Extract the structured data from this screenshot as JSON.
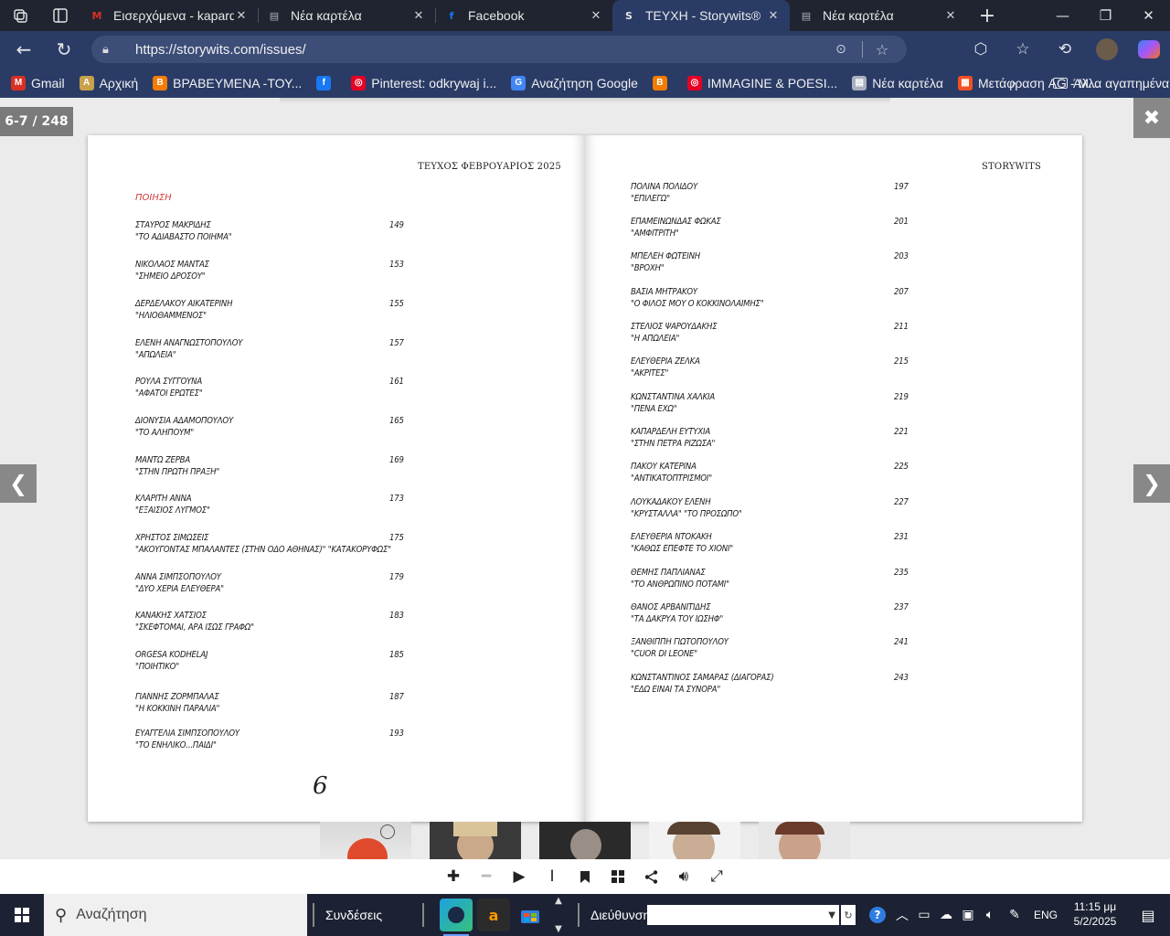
{
  "browser": {
    "tabs": [
      {
        "title": "Εισερχόμενα - kapardeli@",
        "icon": "gmail-icon",
        "color": "#d93025",
        "glyph": "M"
      },
      {
        "title": "Νέα καρτέλα",
        "icon": "newtab-page-icon",
        "color": "#aab0c0",
        "glyph": "▤"
      },
      {
        "title": "Facebook",
        "icon": "facebook-icon",
        "color": "#1877f2",
        "glyph": "f"
      },
      {
        "title": "ΤΕΥΧΗ - Storywits®",
        "icon": "storywits-icon",
        "color": "#e6e6e6",
        "glyph": "S",
        "active": true
      },
      {
        "title": "Νέα καρτέλα",
        "icon": "newtab-page-icon",
        "color": "#aab0c0",
        "glyph": "▤"
      }
    ],
    "url": "https://storywits.com/issues/",
    "bookmarks": [
      {
        "label": "Gmail",
        "color": "#d93025",
        "glyph": "M"
      },
      {
        "label": "Αρχική",
        "color": "#c8a24a",
        "glyph": "A"
      },
      {
        "label": "ΒΡΑΒΕΥΜΕΝΑ -ΤΟΥ...",
        "color": "#f57c00",
        "glyph": "B"
      },
      {
        "label": "",
        "color": "#1877f2",
        "glyph": "f"
      },
      {
        "label": "Pinterest: odkrywaj i...",
        "color": "#e60023",
        "glyph": "◎"
      },
      {
        "label": "Αναζήτηση Google",
        "color": "#4285f4",
        "glyph": "G"
      },
      {
        "label": "",
        "color": "#f57c00",
        "glyph": "B"
      },
      {
        "label": "IMMAGINE & POESI...",
        "color": "#e60023",
        "glyph": "◎"
      },
      {
        "label": "Νέα καρτέλα",
        "color": "#aab0c0",
        "glyph": "▤"
      },
      {
        "label": "Μετάφραση AG - M...",
        "color": "#f25022",
        "glyph": "▦"
      }
    ],
    "other_bookmarks": "Άλλα αγαπημένα"
  },
  "viewer": {
    "page_counter": "6-7 / 248",
    "left_page": {
      "header": "ΤΕΥΧΟΣ ΦΕΒΡΟΥΑΡΙΟΣ 2025",
      "section": "ΠΟΙΗΣΗ",
      "folio": "6",
      "entries": [
        {
          "author": "ΣΤΑΥΡΟΣ ΜΑΚΡΙΔΗΣ",
          "title": "\"ΤΟ ΑΔΙΑΒΑΣΤΟ ΠΟΙΗΜΑ\"",
          "page": "149"
        },
        {
          "author": "ΝΙΚΟΛΑΟΣ ΜΑΝΤΑΣ",
          "title": "\"ΣΗΜΕΙΟ ΔΡΟΣΟΥ\"",
          "page": "153"
        },
        {
          "author": "ΔΕΡΔΕΛΑΚΟΥ ΑΙΚΑΤΕΡΙΝΗ",
          "title": "\"ΗΛΙΟΘΑΜΜΕΝΟΣ\"",
          "page": "155"
        },
        {
          "author": "ΕΛΕΝΗ ΑΝΑΓΝΩΣΤΟΠΟΥΛΟΥ",
          "title": "\"ΑΠΩΛΕΙΑ\"",
          "page": "157"
        },
        {
          "author": "ΡΟΥΛΑ ΣΥΓΓΟΥΝΑ",
          "title": "\"ΑΦΑΤΟΙ ΕΡΩΤΕΣ\"",
          "page": "161"
        },
        {
          "author": "ΔΙΟΝΥΣΙΑ ΑΔΑΜΟΠΟΥΛΟΥ",
          "title": "\"ΤΟ ΑΛΗΠΟΥΜ\"",
          "page": "165"
        },
        {
          "author": "ΜΑΝΤΩ ΖΕΡΒΑ",
          "title": "\"ΣΤΗΝ ΠΡΩΤΗ ΠΡΑΞΗ\"",
          "page": "169"
        },
        {
          "author": "ΚΛΑΡΙΤΗ ΑΝΝΑ",
          "title": "\"ΕΞΑΙΣΙΟΣ ΛΥΓΜΟΣ\"",
          "page": "173"
        },
        {
          "author": "ΧΡΗΣΤΟΣ ΣΙΜΩΣΕΙΣ",
          "title": "\"ΑΚΟΥΓΟΝΤΑΣ ΜΠΑΛΑΝΤΕΣ (ΣΤΗΝ ΟΔΟ ΑΘΗΝΑΣ)\" \"ΚΑΤΑΚΟΡΥΦΩΣ\"",
          "page": "175"
        },
        {
          "author": "ΑΝΝΑ ΣΙΜΠΣΟΠΟΥΛΟΥ",
          "title": "\"ΔΥΟ ΧΕΡΙΑ ΕΛΕΥΘΕΡΑ\"",
          "page": "179"
        },
        {
          "author": "ΚΑΝΑΚΗΣ ΧΑΤΣΙΟΣ",
          "title": "\"ΣΚΕΦΤΟΜΑΙ, ΑΡΑ ΙΣΩΣ ΓΡΑΦΩ\"",
          "page": "183"
        },
        {
          "author": "ORGESA KODHELAJ",
          "title": "\"ΠΟΙΗΤΙΚΟ\"",
          "page": "185"
        },
        {
          "author": "ΓΙΑΝΝΗΣ ΖΟΡΜΠΑΛΑΣ",
          "title": "\"Η ΚΟΚΚΙΝΗ ΠΑΡΑΛΙΑ\"",
          "page": "187"
        },
        {
          "author": "ΕΥΑΓΓΕΛΙΑ ΣΙΜΠΣΟΠΟΥΛΟΥ",
          "title": "\"ΤΟ ΕΝΗΛΙΚΟ...ΠΑΙΔΙ\"",
          "page": "193"
        }
      ]
    },
    "right_page": {
      "header": "STORYWITS",
      "entries": [
        {
          "author": "ΠΟΛΙΝΑ ΠΟΛΙΔΟΥ",
          "title": "\"ΕΠΙΛΕΓΩ\"",
          "page": "197"
        },
        {
          "author": "ΕΠΑΜΕΙΝΩΝΔΑΣ ΦΩΚΑΣ",
          "title": "\"ΑΜΦΙΤΡΙΤΗ\"",
          "page": "201"
        },
        {
          "author": "ΜΠΕΛΕΗ ΦΩΤΕΙΝΗ",
          "title": "\"ΒΡΟΧΗ\"",
          "page": "203"
        },
        {
          "author": "ΒΑΣΙΑ ΜΗΤΡΑΚΟΥ",
          "title": "\"Ο ΦΙΛΟΣ ΜΟΥ Ο ΚΟΚΚΙΝΟΛΑΙΜΗΣ\"",
          "page": "207"
        },
        {
          "author": "ΣΤΕΛΙΟΣ ΨΑΡΟΥΔΑΚΗΣ",
          "title": "\"Η ΑΠΩΛΕΙΑ\"",
          "page": "211"
        },
        {
          "author": "ΕΛΕΥΘΕΡΙΑ ΖΕΛΚΑ",
          "title": "\"ΑΚΡΙΤΕΣ\"",
          "page": "215"
        },
        {
          "author": "ΚΩΝΣΤΑΝΤΙΝΑ ΧΑΛΚΙΑ",
          "title": "\"ΠΕΝΑ ΕΧΩ\"",
          "page": "219"
        },
        {
          "author": "ΚΑΠΑΡΔΕΛΗ ΕΥΤΥΧΙΑ",
          "title": "\"ΣΤΗΝ ΠΕΤΡΑ ΡΙΖΩΣΑ\"",
          "page": "221"
        },
        {
          "author": "ΠΑΚΟΥ ΚΑΤΕΡΙΝΑ",
          "title": "\"ΑΝΤΙΚΑΤΟΠΤΡΙΣΜΟΙ\"",
          "page": "225"
        },
        {
          "author": "ΛΟΥΚΑΔΑΚΟΥ ΕΛΕΝΗ",
          "title": "\"ΚΡΥΣΤΑΛΛΑ\" \"ΤΟ ΠΡΟΣΩΠΟ\"",
          "page": "227"
        },
        {
          "author": "ΕΛΕΥΘΕΡΙΑ ΝΤΟΚΑΚΗ",
          "title": "\"ΚΑΘΩΣ ΕΠΕΦΤΕ ΤΟ ΧΙΟΝΙ\"",
          "page": "231"
        },
        {
          "author": "ΘΕΜΗΣ ΠΑΠΛΙΑΝΑΣ",
          "title": "\"ΤΟ ΑΝΘΡΩΠΙΝΟ ΠΟΤΑΜΙ\"",
          "page": "235"
        },
        {
          "author": "ΘΑΝΟΣ ΑΡΒΑΝΙΤΙΔΗΣ",
          "title": "\"ΤΑ ΔΑΚΡΥΑ ΤΟΥ ΙΩΣΗΦ\"",
          "page": "237"
        },
        {
          "author": "ΞΑΝΘΙΠΠΗ ΓΙΩΤΟΠΟΥΛΟΥ",
          "title": "\"CUOR DI LEONE\"",
          "page": "241"
        },
        {
          "author": "ΚΩΝΣΤΑΝΤΙΝΟΣ ΣΑΜΑΡΑΣ (ΔΙΑΓΟΡΑΣ)",
          "title": "\"ΕΔΩ ΕΙΝΑΙ ΤΑ ΣΥΝΟΡΑ\"",
          "page": "243"
        }
      ]
    },
    "toolbar": [
      "plus-icon",
      "minus-icon",
      "play-icon",
      "text-cursor-icon",
      "bookmark-icon",
      "grid-icon",
      "share-icon",
      "volume-icon",
      "fullscreen-icon"
    ]
  },
  "taskbar": {
    "search_placeholder": "Αναζήτηση",
    "connections_label": "Συνδέσεις",
    "address_label": "Διεύθυνση",
    "language": "ENG",
    "time": "11:15 μμ",
    "date": "5/2/2025"
  }
}
